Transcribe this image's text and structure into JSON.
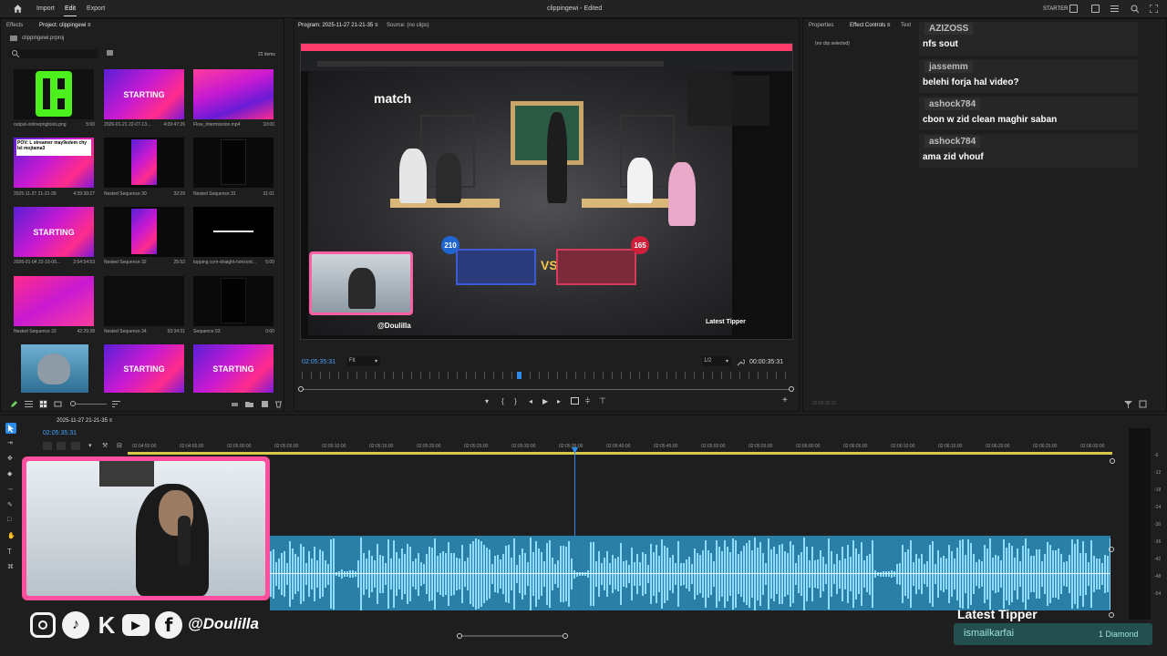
{
  "menu": {
    "import": "Import",
    "edit": "Edit",
    "export": "Export"
  },
  "title": "clippingewi - Edited",
  "topbar_right": "STARTER",
  "left_panel": {
    "tab_effects": "Effects",
    "tab_project": "Project: clippingewi ≡",
    "project_file": "clippingewi.prproj",
    "item_count": "22 items",
    "items": [
      {
        "name": "output-onlinepngtools.png",
        "duration": "5:00"
      },
      {
        "name": "2026-01-21 22-07-13...",
        "duration": "4:09:47:26",
        "label": "STARTING"
      },
      {
        "name": "Flow_Intermission.mp4",
        "duration": "10:00"
      },
      {
        "name": "2025-11-27 21-21-35",
        "duration": "4:39:39:27",
        "label": "POV: L streamer may9edem chy lel mojtama3"
      },
      {
        "name": "Nested Sequence 30",
        "duration": "32:29"
      },
      {
        "name": "Nested Sequence 31",
        "duration": "31:01"
      },
      {
        "name": "2026-01-04 22-16-00...",
        "duration": "2:54:54:53",
        "label": "STARTING"
      },
      {
        "name": "Nested Sequence 32",
        "duration": "25:52"
      },
      {
        "name": "topping.com-straight-horizont...",
        "duration": "5:00"
      },
      {
        "name": "Nested Sequence 33",
        "duration": "42:29:28"
      },
      {
        "name": "Nested Sequence 34",
        "duration": "53:34:31"
      },
      {
        "name": "Sequence 03",
        "duration": "0:00"
      },
      {
        "name": "",
        "duration": ""
      },
      {
        "name": "",
        "duration": "",
        "label": "STARTING"
      },
      {
        "name": "",
        "duration": "",
        "label": "STARTING"
      }
    ]
  },
  "program": {
    "tab_program": "Program: 2025-11-27 21-21-35 ≡",
    "tab_source": "Source: (no clips)",
    "timecode": "02:05:35:31",
    "fit": "Fit",
    "quality": "1/2",
    "duration": "00:00:35:31",
    "overlay": {
      "brand": "match",
      "score_left": "210",
      "score_right": "165",
      "handle": "@Doulilla",
      "latest_tipper": "Latest Tipper"
    }
  },
  "right_panel": {
    "tab_properties": "Properties",
    "tab_effect_controls": "Effect Controls ≡",
    "tab_text": "Text",
    "no_clip": "(no clip selected)"
  },
  "chat": [
    {
      "user": "AZIZOSS",
      "text": "nfs sout",
      "color": "#cfe8ff"
    },
    {
      "user": "jassemm",
      "text": "belehi forja hal video?",
      "color": "#8ee3a8"
    },
    {
      "user": "ashock784",
      "text": "cbon w zid clean maghir saban",
      "color": "#e0455e"
    },
    {
      "user": "ashock784",
      "text": "ama zid vhouf",
      "color": "#e0455e"
    }
  ],
  "timeline": {
    "sequence_name": "2025-11-27 21-21-35 ≡",
    "timecode": "02:05:35:31",
    "ruler": [
      "02:04:50:00",
      "02:04:55:00",
      "02:05:00:00",
      "02:05:05:00",
      "02:05:10:00",
      "02:05:15:00",
      "02:05:20:00",
      "02:05:25:00",
      "02:05:30:00",
      "02:05:35:00",
      "02:05:40:00",
      "02:05:45:00",
      "02:05:50:00",
      "02:05:55:00",
      "02:06:00:00",
      "02:06:05:00",
      "02:06:10:00",
      "02:06:15:00",
      "02:06:20:00",
      "02:06:25:00",
      "02:06:30:00"
    ],
    "meter_labels": [
      "-6",
      "-12",
      "-18",
      "-24",
      "-30",
      "-36",
      "-42",
      "-48",
      "-54"
    ]
  },
  "stream_overlay": {
    "handle": "@Doulilla",
    "latest_tipper": "Latest Tipper",
    "tipper_name": "ismailkarfai",
    "tipper_amount": "1 Diamond"
  },
  "colors": {
    "accent": "#2d8ceb",
    "brand_pink": "#ff3b8f",
    "wave": "#8fdcff"
  }
}
